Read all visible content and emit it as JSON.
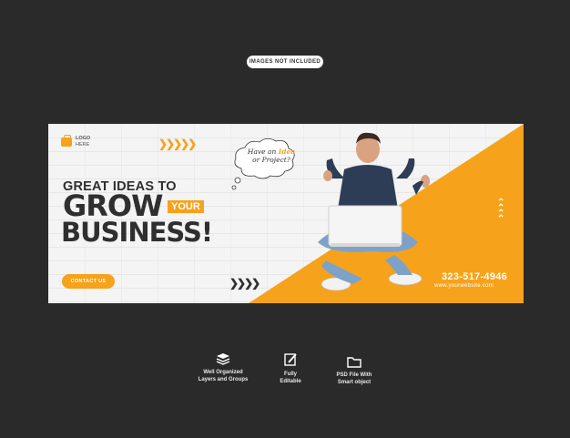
{
  "watermark": {
    "label": "IMAGES NOT INCLUDED"
  },
  "banner": {
    "logo": {
      "title": "LOGO",
      "subtitle": "HERE"
    },
    "headline_top": "GREAT IDEAS TO",
    "headline_grow": "GROW",
    "headline_your": "YOUR",
    "headline_business": "BUSINESS!",
    "contact_label": "CONTACT US",
    "bubble": {
      "line1_pre": "Have an ",
      "line1_em": "Idea",
      "line2": "or Project?"
    },
    "phone": "323-517-4946",
    "website": "www.yourwebsite.com",
    "chevrons_top": "❯❯❯❯❯",
    "chevrons_bottom": "❯❯❯❯",
    "accent_color": "#f7a21b",
    "dark_color": "#2f2f2f"
  },
  "features": [
    {
      "icon": "layers-icon",
      "line1": "Well Organized",
      "line2": "Layers and Groups"
    },
    {
      "icon": "edit-icon",
      "line1": "Fully",
      "line2": "Editable"
    },
    {
      "icon": "folder-icon",
      "line1": "PSD File With",
      "line2": "Smart object"
    }
  ]
}
